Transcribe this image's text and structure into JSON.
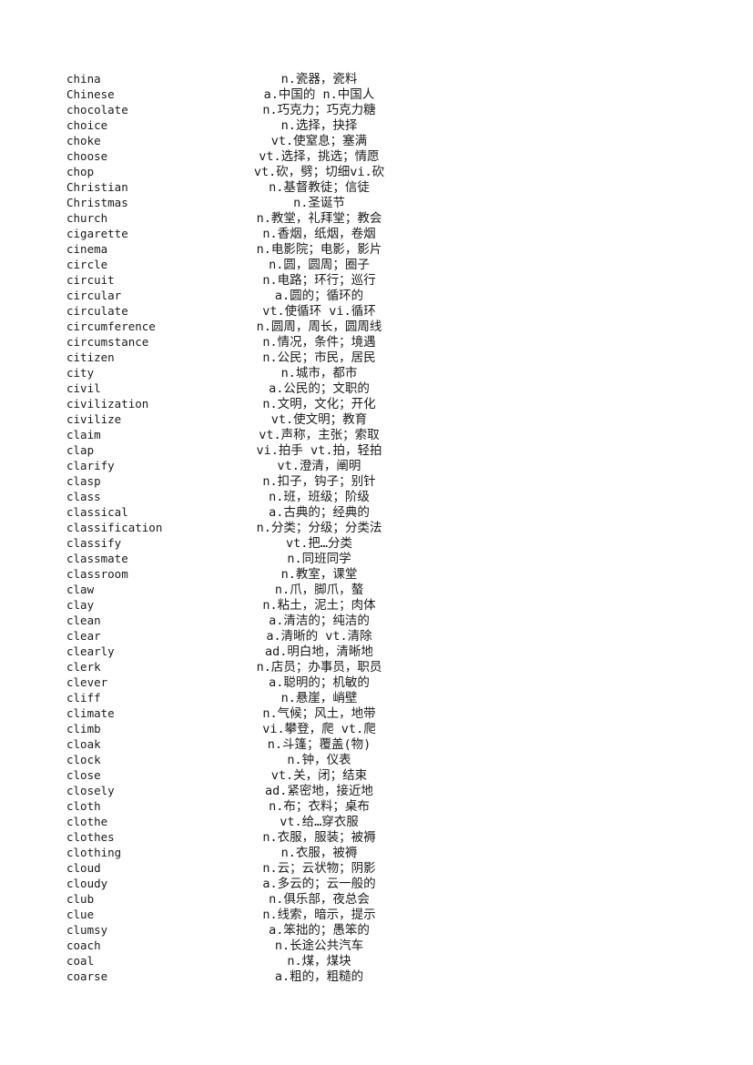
{
  "document": {
    "background_color": "#ffffff",
    "text_color": "#1a1a1a",
    "columns": {
      "term_header": "",
      "definition_header": ""
    }
  },
  "entries": [
    {
      "term": "china",
      "definition": "n.瓷器，瓷料"
    },
    {
      "term": "Chinese",
      "definition": "a.中国的 n.中国人"
    },
    {
      "term": "chocolate",
      "definition": "n.巧克力；巧克力糖"
    },
    {
      "term": "choice",
      "definition": "n.选择，抉择"
    },
    {
      "term": "choke",
      "definition": "vt.使窒息；塞满"
    },
    {
      "term": "choose",
      "definition": "vt.选择，挑选；情愿"
    },
    {
      "term": "chop",
      "definition": "vt.砍，劈；切细vi.砍"
    },
    {
      "term": "Christian",
      "definition": "n.基督教徒；信徒"
    },
    {
      "term": "Christmas",
      "definition": "n.圣诞节"
    },
    {
      "term": "church",
      "definition": "n.教堂，礼拜堂；教会"
    },
    {
      "term": "cigarette",
      "definition": "n.香烟，纸烟，卷烟"
    },
    {
      "term": "cinema",
      "definition": "n.电影院；电影，影片"
    },
    {
      "term": "circle",
      "definition": "n.圆，圆周；圈子"
    },
    {
      "term": "circuit",
      "definition": "n.电路；环行；巡行"
    },
    {
      "term": "circular",
      "definition": "a.圆的；循环的"
    },
    {
      "term": "circulate",
      "definition": "vt.使循环 vi.循环"
    },
    {
      "term": "circumference",
      "definition": "n.圆周，周长，圆周线"
    },
    {
      "term": "circumstance",
      "definition": "n.情况，条件；境遇"
    },
    {
      "term": "citizen",
      "definition": "n.公民；市民，居民"
    },
    {
      "term": "city",
      "definition": "n.城市，都市"
    },
    {
      "term": "civil",
      "definition": "a.公民的；文职的"
    },
    {
      "term": "civilization",
      "definition": "n.文明，文化；开化"
    },
    {
      "term": "civilize",
      "definition": "vt.使文明；教育"
    },
    {
      "term": "claim",
      "definition": "vt.声称，主张；索取"
    },
    {
      "term": "clap",
      "definition": "vi.拍手 vt.拍，轻拍"
    },
    {
      "term": "clarify",
      "definition": "vt.澄清，阐明"
    },
    {
      "term": "clasp",
      "definition": "n.扣子，钩子；别针"
    },
    {
      "term": "class",
      "definition": "n.班，班级；阶级"
    },
    {
      "term": "classical",
      "definition": "a.古典的；经典的"
    },
    {
      "term": "classification",
      "definition": "n.分类；分级；分类法"
    },
    {
      "term": "classify",
      "definition": "vt.把…分类"
    },
    {
      "term": "classmate",
      "definition": "n.同班同学"
    },
    {
      "term": "classroom",
      "definition": "n.教室，课堂"
    },
    {
      "term": "claw",
      "definition": "n.爪，脚爪，螯"
    },
    {
      "term": "clay",
      "definition": "n.粘土，泥土；肉体"
    },
    {
      "term": "clean",
      "definition": "a.清洁的；纯洁的"
    },
    {
      "term": "clear",
      "definition": "a.清晰的 vt.清除"
    },
    {
      "term": "clearly",
      "definition": "ad.明白地，清晰地"
    },
    {
      "term": "clerk",
      "definition": "n.店员；办事员，职员"
    },
    {
      "term": "clever",
      "definition": "a.聪明的；机敏的"
    },
    {
      "term": "cliff",
      "definition": "n.悬崖，峭壁"
    },
    {
      "term": "climate",
      "definition": "n.气候；风土，地带"
    },
    {
      "term": "climb",
      "definition": "vi.攀登，爬 vt.爬"
    },
    {
      "term": "cloak",
      "definition": "n.斗篷；覆盖(物)"
    },
    {
      "term": "clock",
      "definition": "n.钟，仪表"
    },
    {
      "term": "close",
      "definition": "vt.关，闭；结束"
    },
    {
      "term": "closely",
      "definition": "ad.紧密地，接近地"
    },
    {
      "term": "cloth",
      "definition": "n.布；衣料；桌布"
    },
    {
      "term": "clothe",
      "definition": "vt.给…穿衣服"
    },
    {
      "term": "clothes",
      "definition": "n.衣服，服装；被褥"
    },
    {
      "term": "clothing",
      "definition": "n.衣服，被褥"
    },
    {
      "term": "cloud",
      "definition": "n.云；云状物；阴影"
    },
    {
      "term": "cloudy",
      "definition": "a.多云的；云一般的"
    },
    {
      "term": "club",
      "definition": "n.俱乐部，夜总会"
    },
    {
      "term": "clue",
      "definition": "n.线索，暗示，提示"
    },
    {
      "term": "clumsy",
      "definition": "a.笨拙的；愚笨的"
    },
    {
      "term": "coach",
      "definition": "n.长途公共汽车"
    },
    {
      "term": "coal",
      "definition": "n.煤，煤块"
    },
    {
      "term": "coarse",
      "definition": "a.粗的，粗糙的"
    }
  ]
}
